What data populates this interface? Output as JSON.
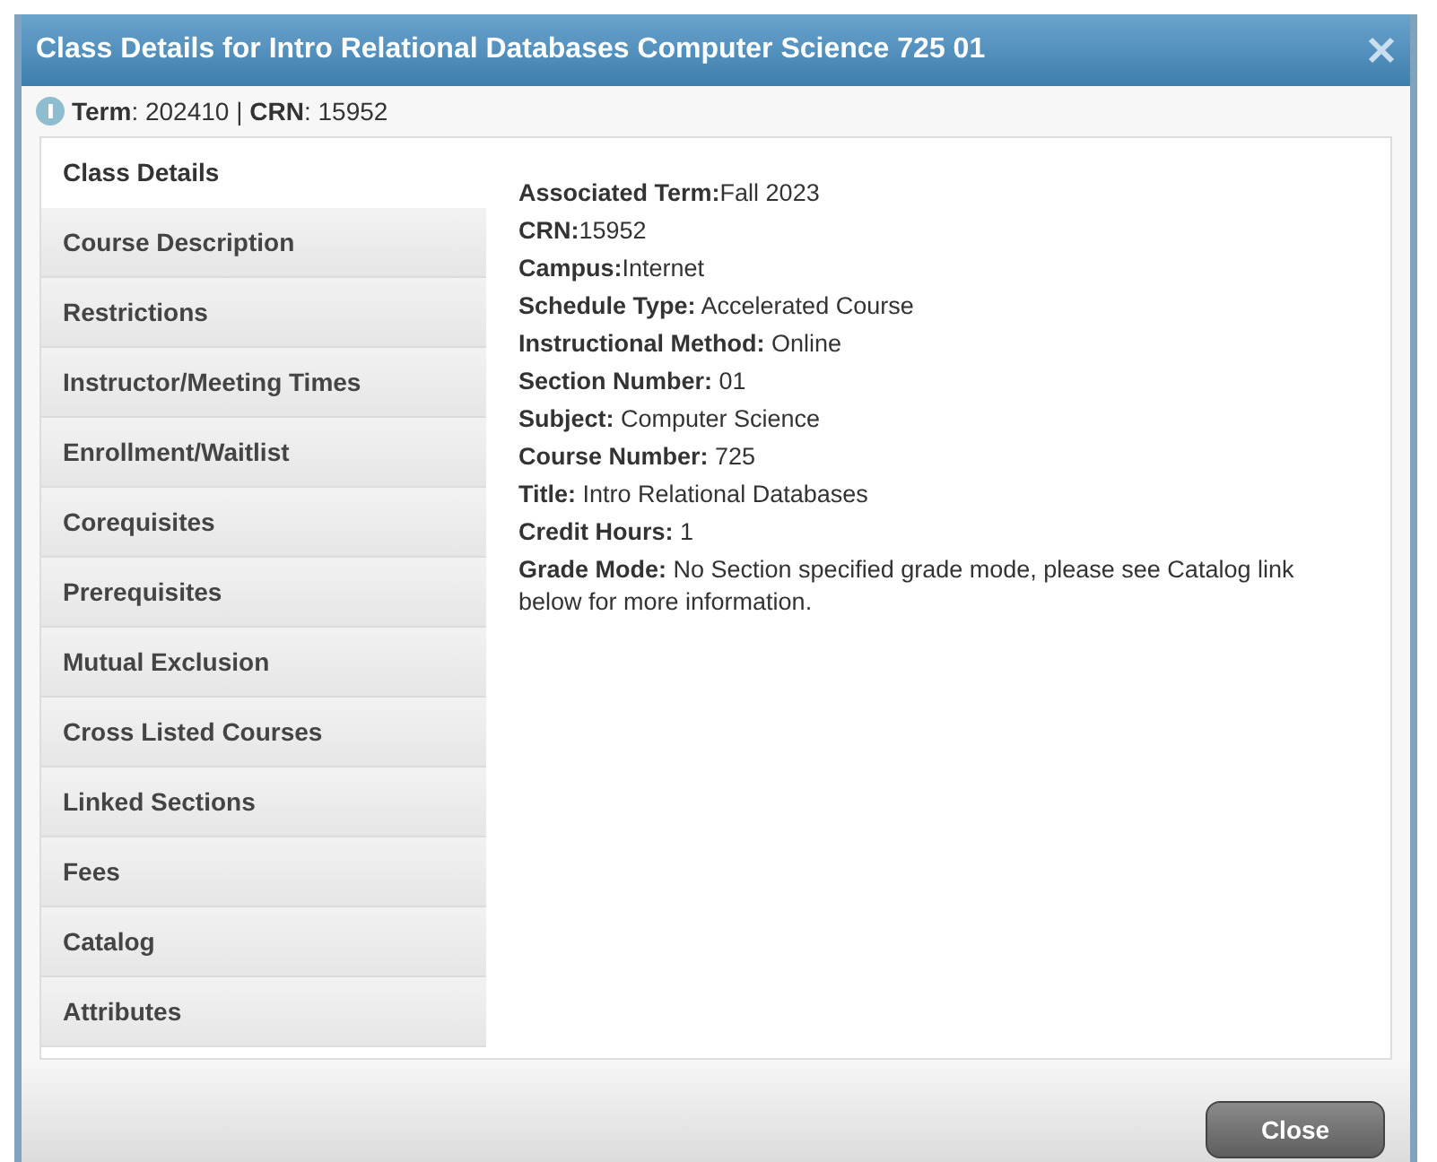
{
  "window": {
    "title": "Class Details for Intro Relational Databases Computer Science 725 01"
  },
  "info": "**Term**: 202410 | **CRN**: 15952",
  "tabs": [
    {
      "label": "Class Details",
      "selected": true
    },
    {
      "label": "Course Description",
      "selected": false
    },
    {
      "label": "Restrictions",
      "selected": false
    },
    {
      "label": "Instructor/Meeting Times",
      "selected": false
    },
    {
      "label": "Enrollment/Waitlist",
      "selected": false
    },
    {
      "label": "Corequisites",
      "selected": false
    },
    {
      "label": "Prerequisites",
      "selected": false
    },
    {
      "label": "Mutual Exclusion",
      "selected": false
    },
    {
      "label": "Cross Listed Courses",
      "selected": false
    },
    {
      "label": "Linked Sections",
      "selected": false
    },
    {
      "label": "Fees",
      "selected": false
    },
    {
      "label": "Catalog",
      "selected": false
    },
    {
      "label": "Attributes",
      "selected": false
    }
  ],
  "details": [
    "**Associated Term:**Fall 2023",
    "**CRN:**15952",
    "**Campus:**Internet",
    "**Schedule Type:** Accelerated Course",
    "**Instructional Method:** Online",
    "**Section Number:** 01",
    "**Subject:** Computer Science",
    "**Course Number:** 725",
    "**Title:** Intro Relational Databases",
    "**Credit Hours:** 1",
    "**Grade Mode:** No Section specified grade mode, please see Catalog link below for more information."
  ],
  "buttons": [
    "Close"
  ]
}
